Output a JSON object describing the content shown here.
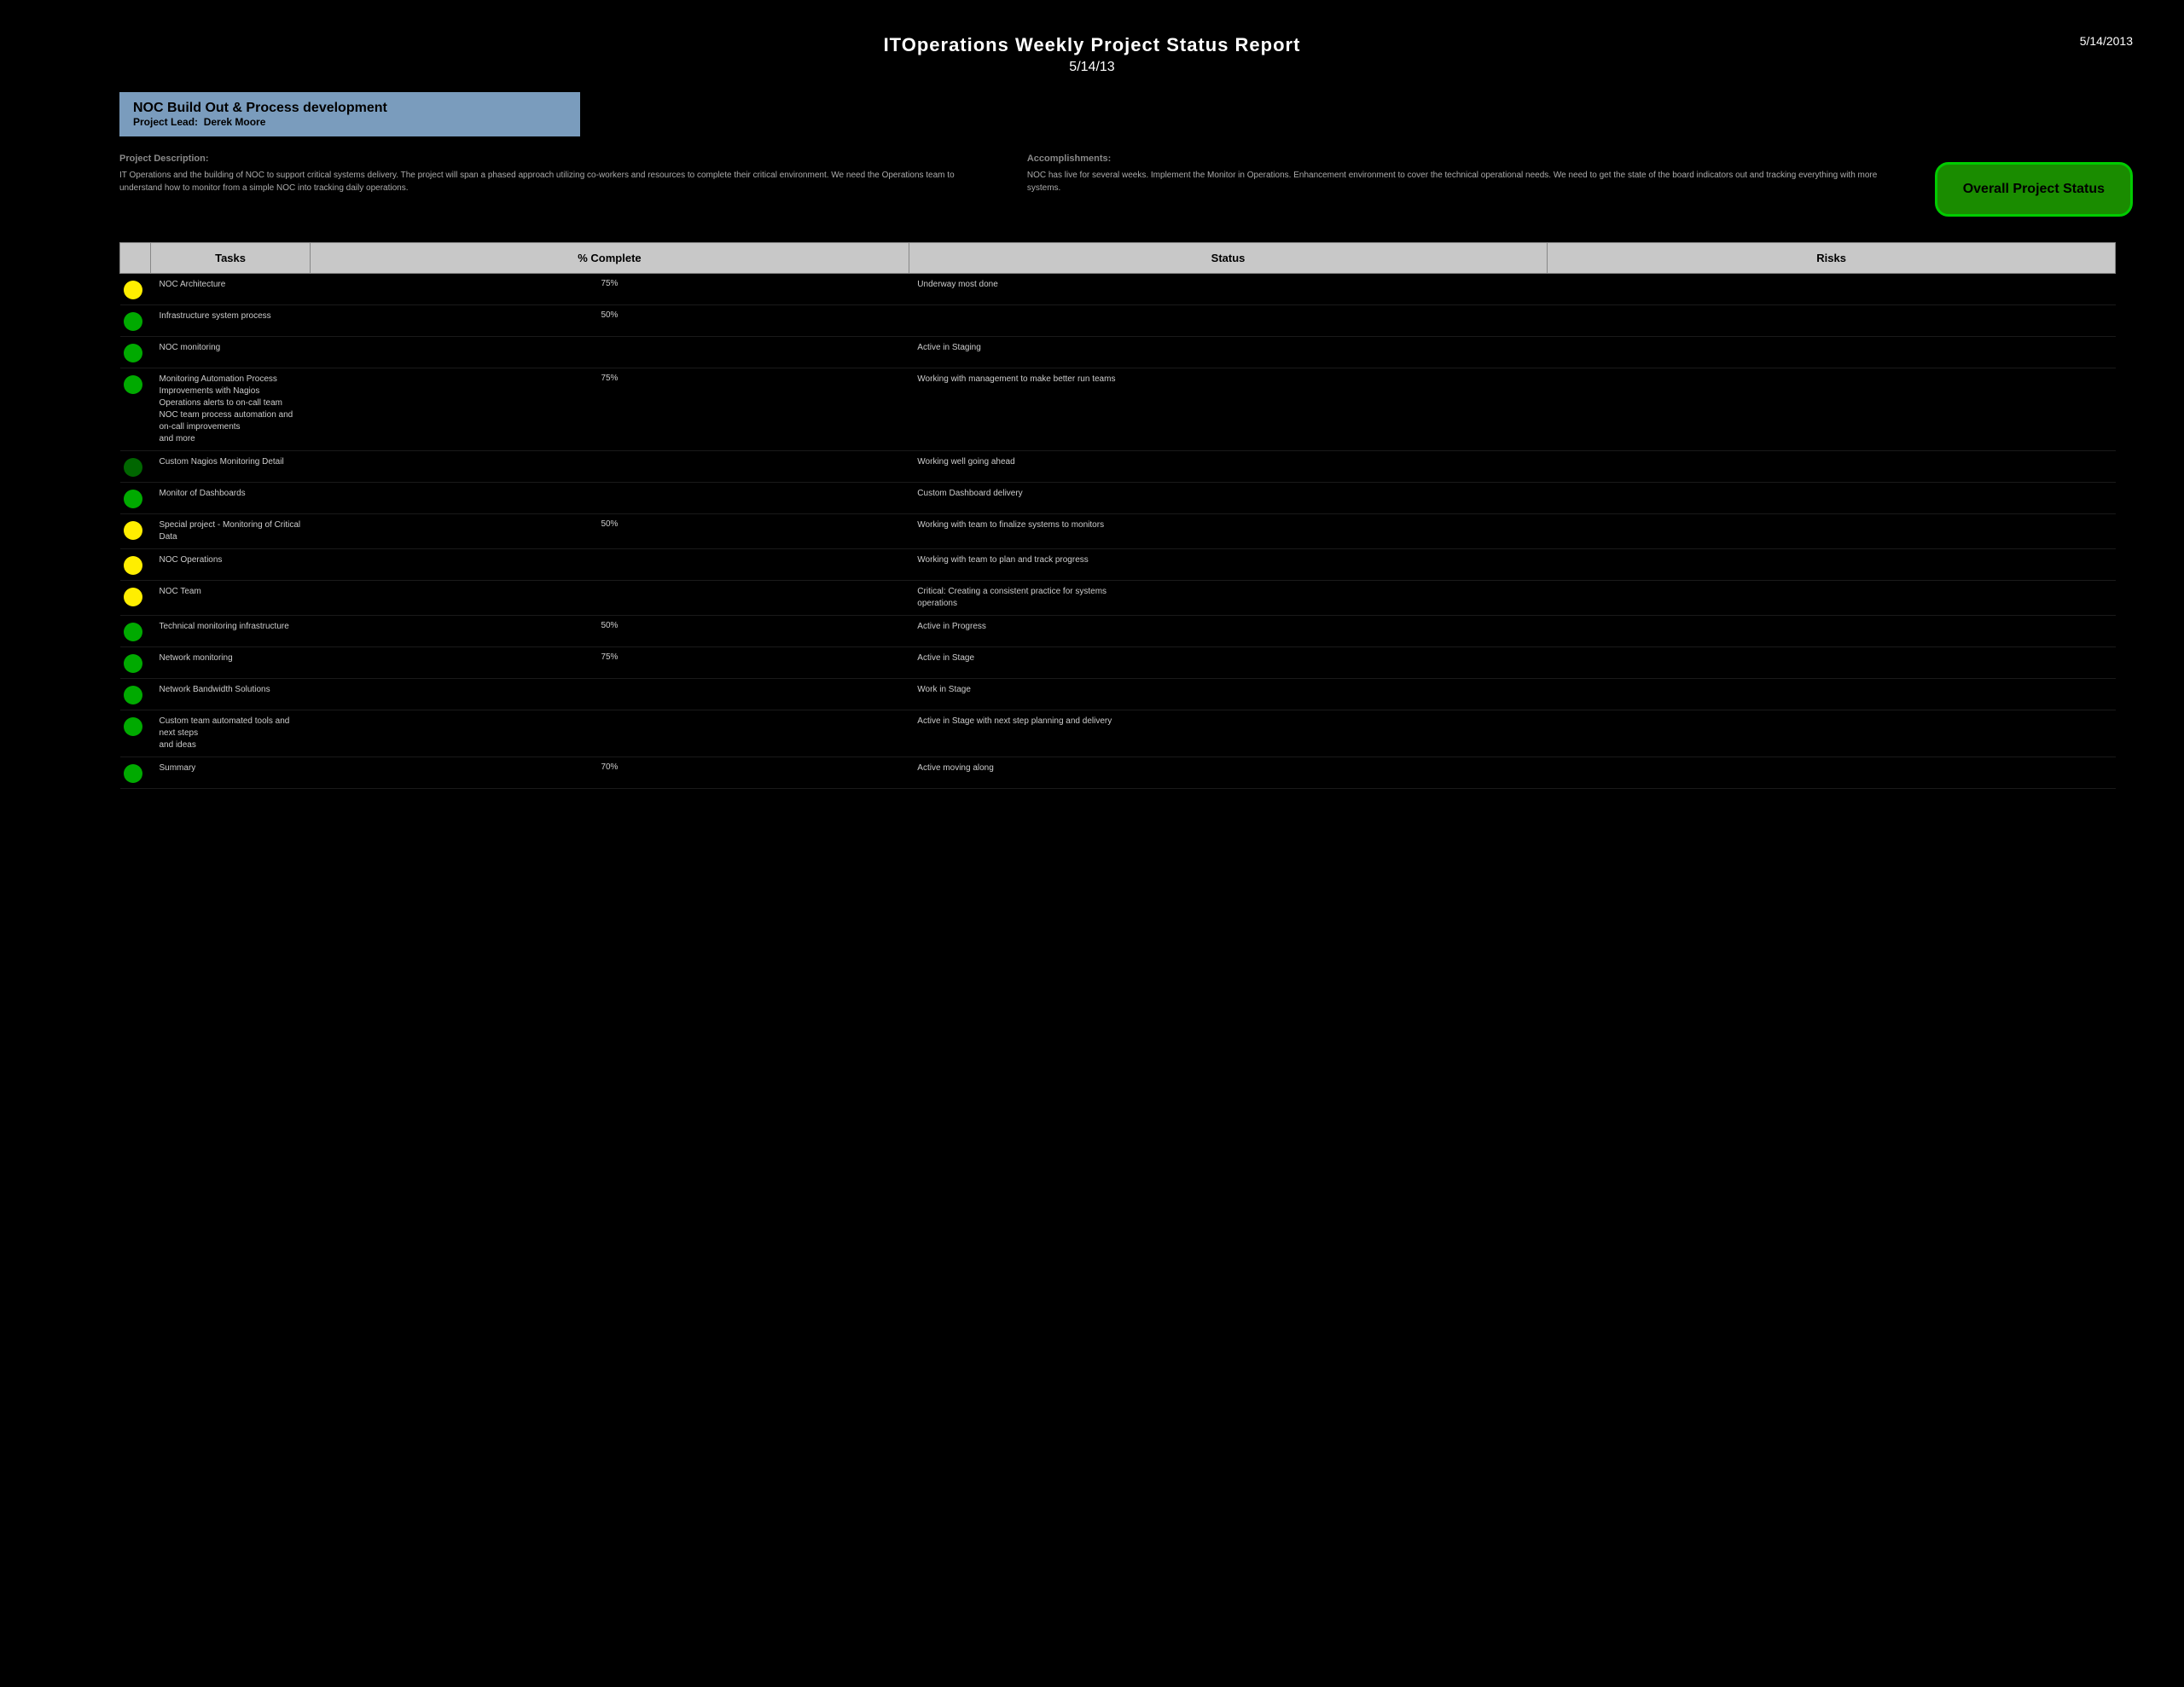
{
  "header": {
    "title": "ITOperations Weekly Project Status Report",
    "subtitle": "5/14/13",
    "date": "5/14/2013"
  },
  "project": {
    "title": "NOC Build Out & Process development",
    "lead_label": "Project Lead:",
    "lead_name": "Derek Moore"
  },
  "sections": {
    "description_label": "Project Description:",
    "description_text": "IT Operations and the building of NOC to support critical systems delivery. The project will span a phased approach utilizing co-workers and resources to complete their critical environment. We need the Operations team to understand how to monitor from a simple NOC into tracking daily operations.",
    "accomplishments_label": "Accomplishments:",
    "accomplishments_text": "NOC has live for several weeks. Implement the Monitor in Operations. Enhancement environment to cover the technical operational needs. We need to get the state of the board indicators out and tracking everything with more systems."
  },
  "overall_status": {
    "label": "Overall Project Status"
  },
  "table": {
    "headers": [
      "Tasks",
      "% Complete",
      "Status",
      "Risks"
    ],
    "rows": [
      {
        "indicator": "yellow",
        "task": "NOC Architecture",
        "pct": "75%",
        "status": "Underway most done",
        "risks": ""
      },
      {
        "indicator": "green",
        "task": "Infrastructure system process",
        "pct": "50%",
        "status": "",
        "risks": ""
      },
      {
        "indicator": "green",
        "task": "NOC monitoring",
        "pct": "",
        "status": "Active in Staging",
        "risks": ""
      },
      {
        "indicator": "green",
        "task": "Monitoring Automation Process Improvements with Nagios\nOperations alerts to on-call team\nNOC team process automation and on-call improvements\nand more",
        "pct": "75%",
        "status": "Working with management to make better run teams",
        "risks": ""
      },
      {
        "indicator": "dark-green",
        "task": "Custom Nagios Monitoring Detail",
        "pct": "",
        "status": "Working well going ahead",
        "risks": ""
      },
      {
        "indicator": "green",
        "task": "Monitor of Dashboards",
        "pct": "",
        "status": "Custom Dashboard delivery",
        "risks": ""
      },
      {
        "indicator": "yellow",
        "task": "Special project - Monitoring of Critical Data",
        "pct": "50%",
        "status": "Working with team to finalize systems to monitors",
        "risks": ""
      },
      {
        "indicator": "yellow",
        "task": "NOC Operations",
        "pct": "",
        "status": "Working with team to plan and track progress",
        "risks": ""
      },
      {
        "indicator": "yellow",
        "task": "NOC Team",
        "pct": "",
        "status": "Critical: Creating a consistent practice for systems\noperations",
        "risks": ""
      },
      {
        "indicator": "green",
        "task": "Technical monitoring infrastructure",
        "pct": "50%",
        "status": "Active in Progress",
        "risks": ""
      },
      {
        "indicator": "green",
        "task": "Network monitoring",
        "pct": "75%",
        "status": "Active in Stage",
        "risks": ""
      },
      {
        "indicator": "green",
        "task": "Network Bandwidth Solutions",
        "pct": "",
        "status": "Work in Stage",
        "risks": ""
      },
      {
        "indicator": "green",
        "task": "Custom team automated tools and next steps\nand ideas",
        "pct": "",
        "status": "Active in Stage with next step planning and delivery",
        "risks": ""
      },
      {
        "indicator": "green",
        "task": "Summary",
        "pct": "70%",
        "status": "Active moving along",
        "risks": ""
      }
    ]
  }
}
